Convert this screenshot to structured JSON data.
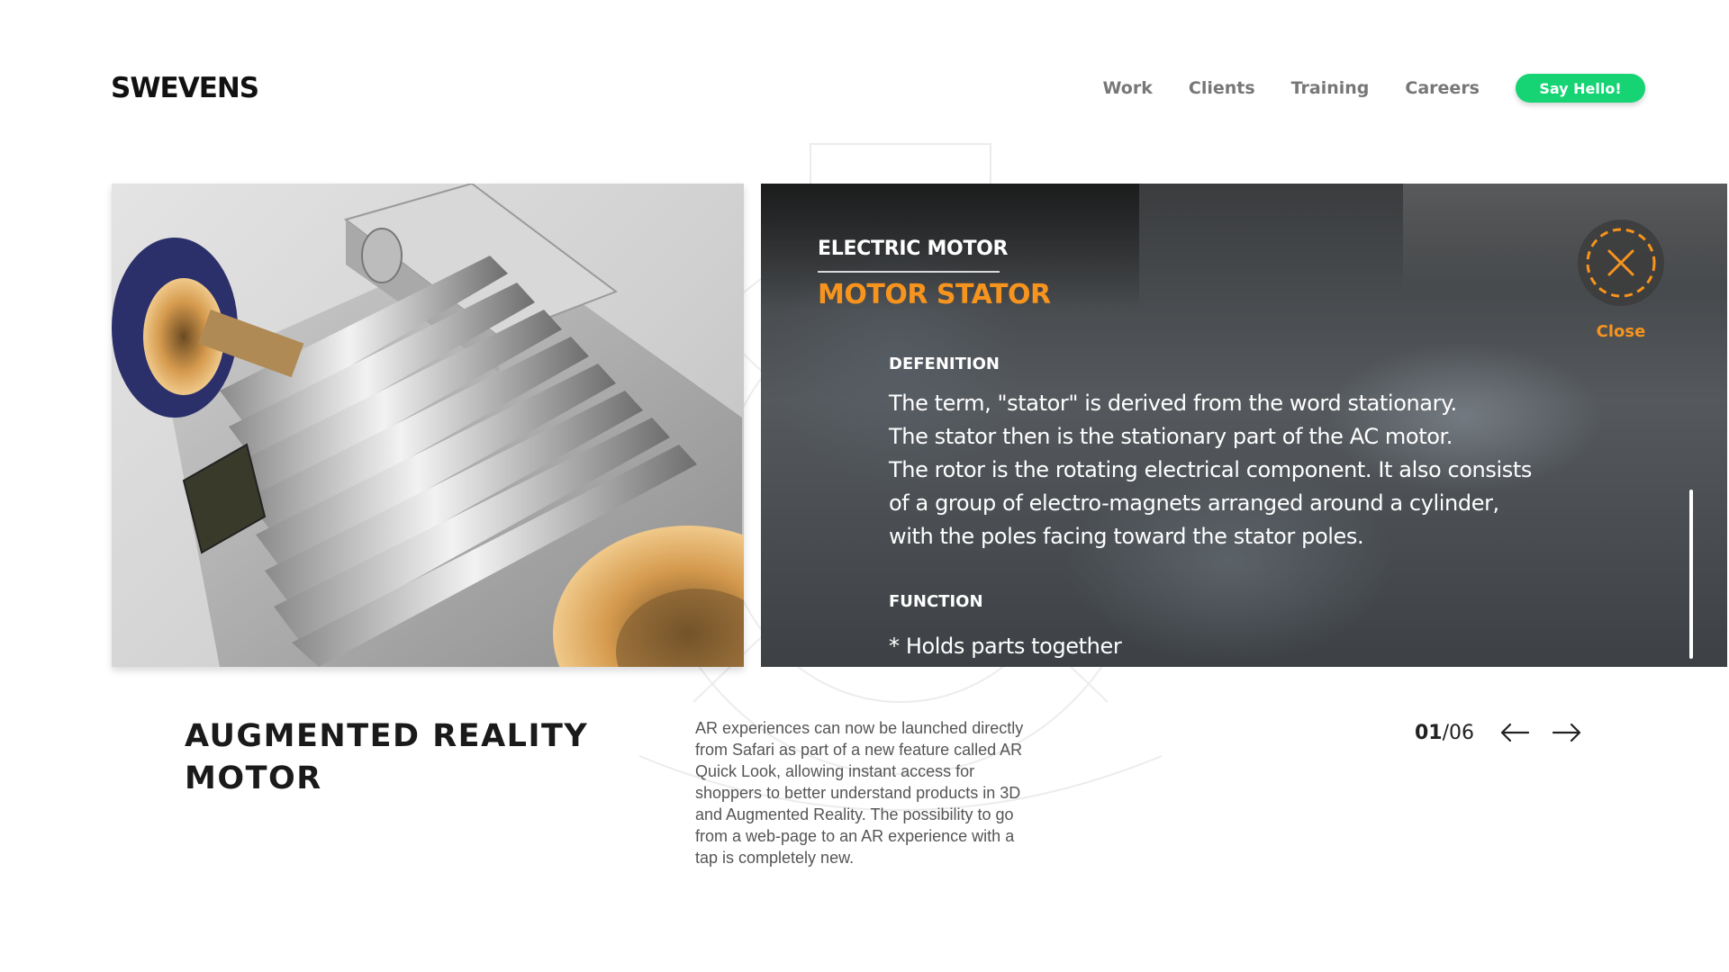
{
  "header": {
    "logo": "SWEVENS",
    "nav": [
      {
        "label": "Work"
      },
      {
        "label": "Clients"
      },
      {
        "label": "Training"
      },
      {
        "label": "Careers"
      }
    ],
    "cta_label": "Say Hello!"
  },
  "ar_panel": {
    "overline": "ELECTRIC MOTOR",
    "title": "MOTOR STATOR",
    "definition_label": "DEFENITION",
    "definition_lines": [
      "The term, \"stator\" is derived from the word stationary.",
      "The stator then is the stationary part of the AC motor.",
      "The rotor is the rotating electrical component. It also consists",
      "of a group of electro-magnets arranged around a cylinder,",
      "with the poles facing toward the stator poles."
    ],
    "function_label": "FUNCTION",
    "function_item": "* Holds parts together",
    "close_label": "Close",
    "accent_color": "#f7941d"
  },
  "caption": {
    "title_line1": "AUGMENTED REALITY",
    "title_line2": "MOTOR",
    "description": "AR experiences can now be launched directly from Safari as part of a new feature called AR Quick Look, allowing instant access for shoppers to better understand products in 3D and Augmented Reality. The possibility to go from a web-page to an AR experience with a tap is completely new."
  },
  "pager": {
    "current": "01",
    "separator": "/",
    "total": "06",
    "prev_icon": "arrow-left-icon",
    "next_icon": "arrow-right-icon"
  },
  "colors": {
    "cta_green": "#16d474",
    "text_dark": "#1a1a1a",
    "nav_gray": "#777777"
  }
}
